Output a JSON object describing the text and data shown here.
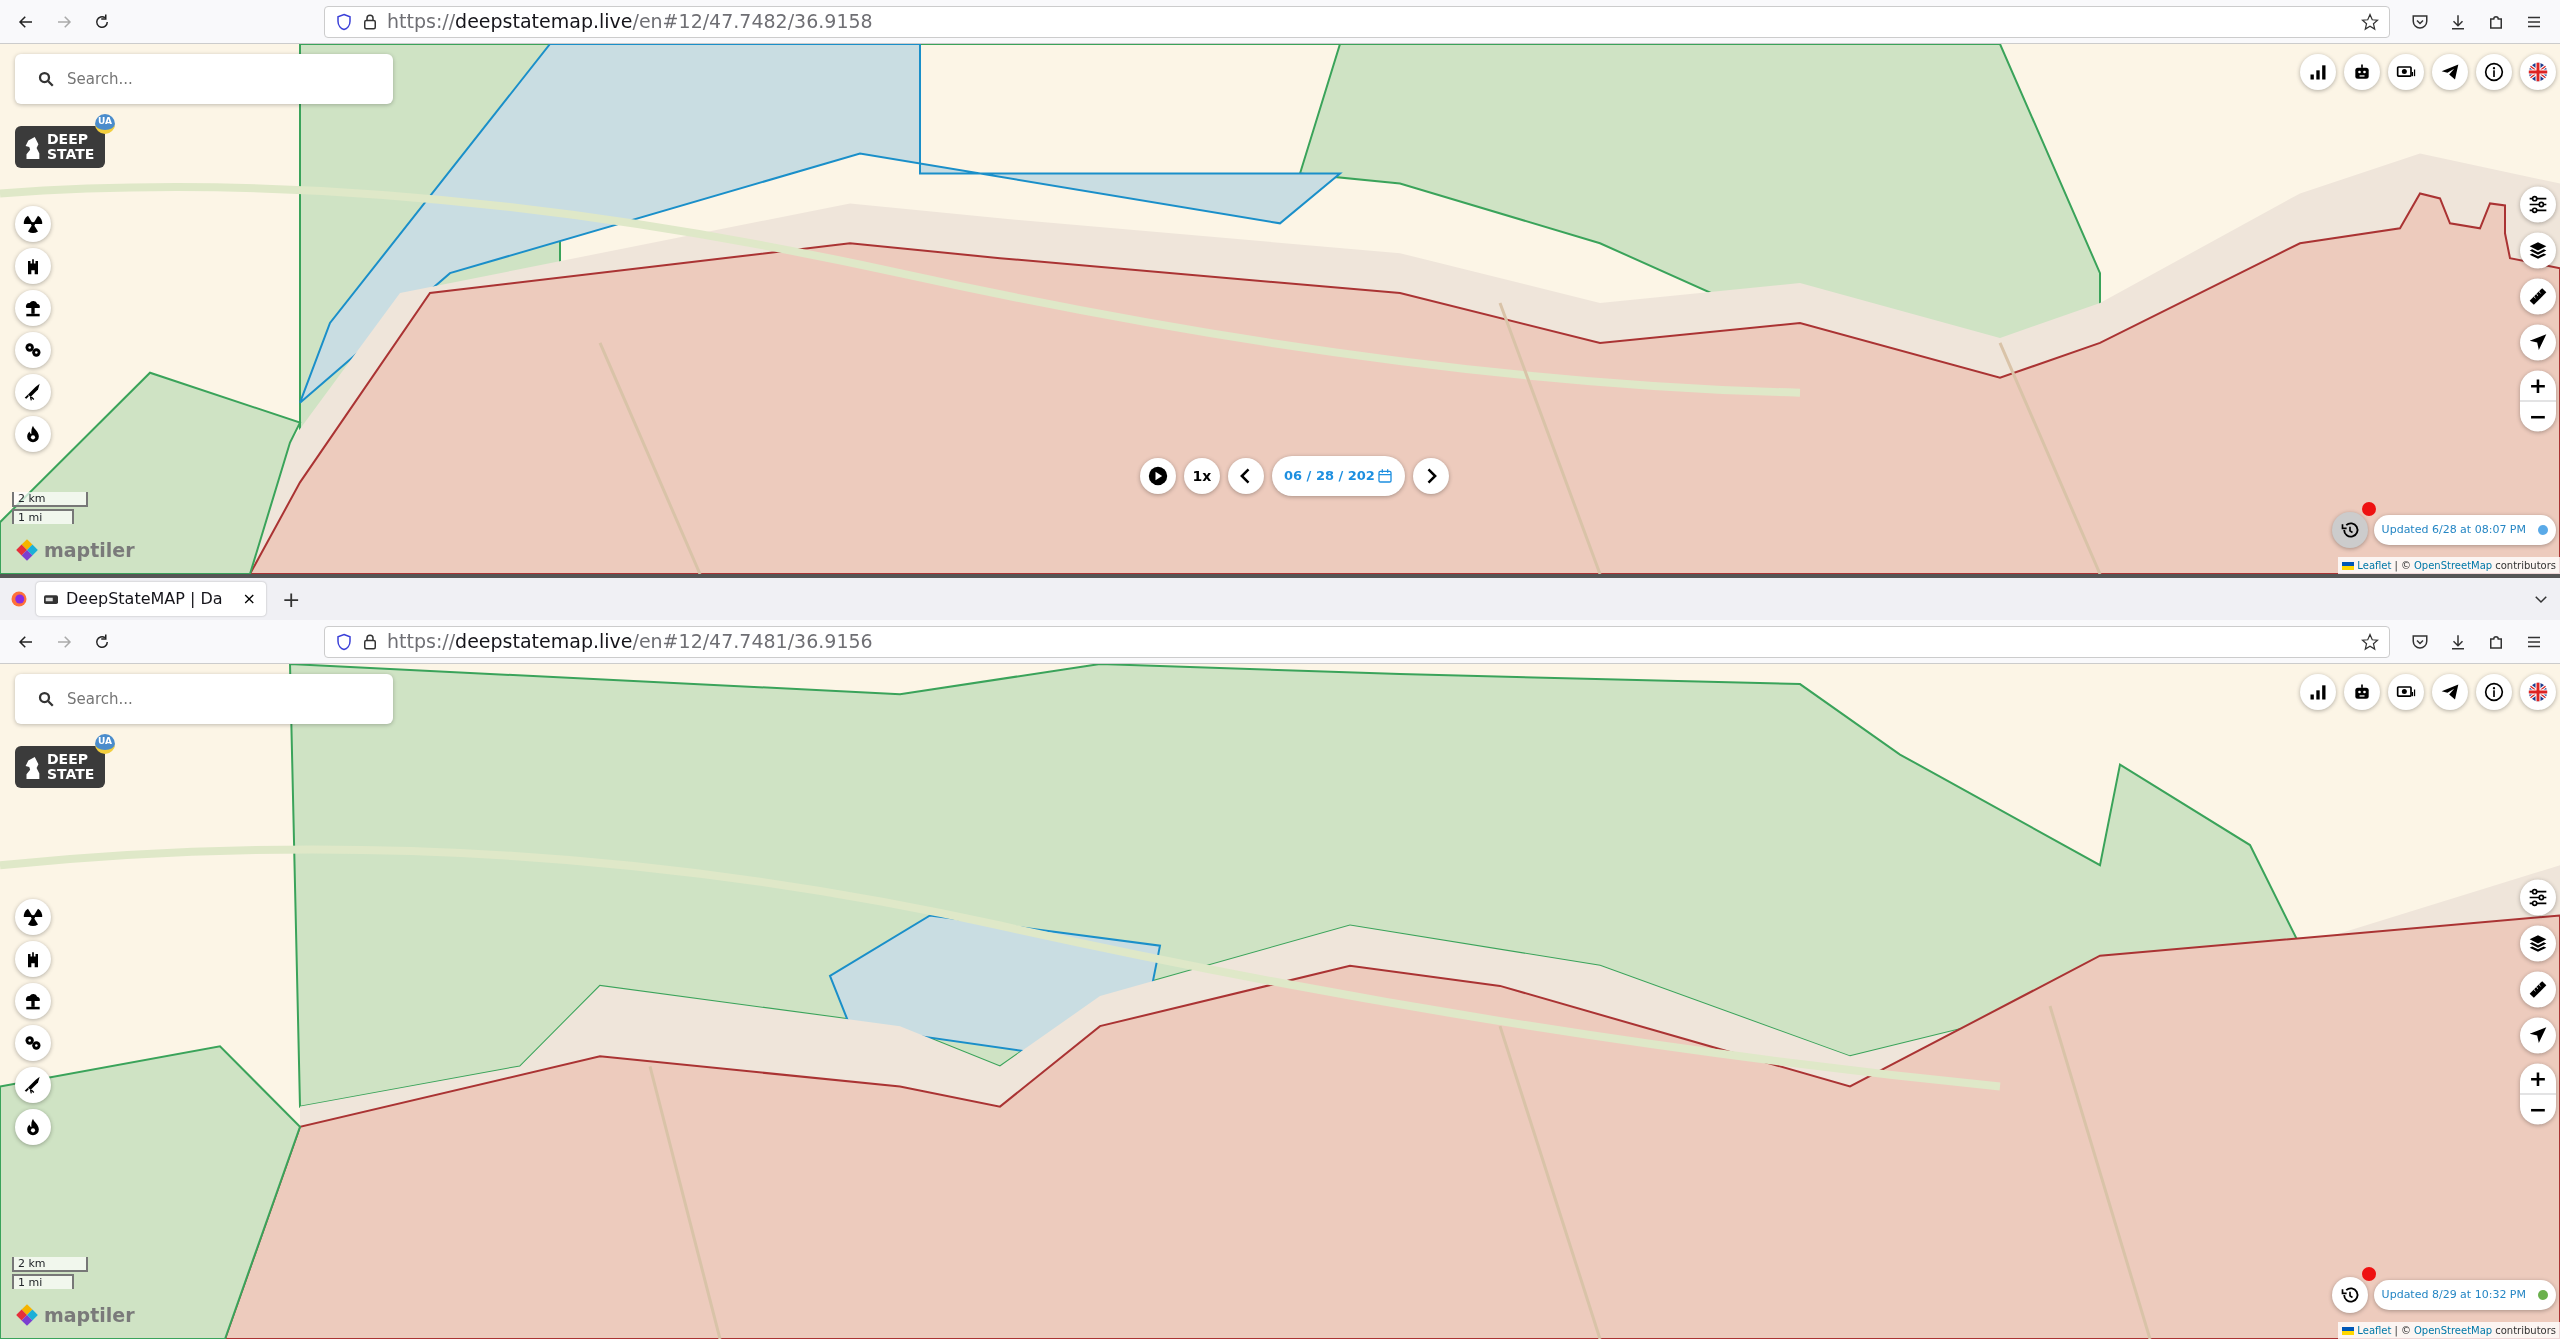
{
  "windows": [
    {
      "url": {
        "scheme": "https://",
        "host": "deepstatemap.live",
        "path": "/en#12/47.7482/36.9158"
      },
      "nav": [
        {
          "kind": "back",
          "disabled": false
        },
        {
          "kind": "forward",
          "disabled": true
        },
        {
          "kind": "reload",
          "disabled": false
        }
      ],
      "map": {
        "kind": "picture",
        "search": {
          "placeholder": "Search..."
        },
        "logo": {
          "line1": "DEEP",
          "line2": "STATE",
          "badge": "UA"
        },
        "layer_buttons": [
          {
            "kind": "radiation"
          },
          {
            "kind": "tower"
          },
          {
            "kind": "explosion"
          },
          {
            "kind": "gears"
          },
          {
            "kind": "rocket"
          },
          {
            "kind": "fire"
          }
        ],
        "scale": {
          "metric": "2 km",
          "imperial": "1 mi"
        },
        "maptiler": "maptiler",
        "timeline": {
          "speed": "1x",
          "date": "06 / 28 / 202"
        },
        "top_buttons": [
          {
            "kind": "stats"
          },
          {
            "kind": "robot"
          },
          {
            "kind": "donate"
          },
          {
            "kind": "telegram"
          },
          {
            "kind": "info"
          },
          {
            "kind": "flag"
          }
        ],
        "tool_buttons": [
          {
            "kind": "filters"
          },
          {
            "kind": "layers"
          },
          {
            "kind": "ruler"
          },
          {
            "kind": "locate"
          }
        ],
        "zoom": {
          "in": "+",
          "out": "−"
        },
        "updated": {
          "text": "Updated 6/28 at 08:07 PM",
          "color": "#5aaae8"
        },
        "attribution": {
          "link1": "Leaflet",
          "separator": "| ©",
          "link2": "OpenStreetMap",
          "suffix": "contributors"
        }
      }
    },
    {
      "tabs": [
        {
          "title": "DeepStateMAP | Da",
          "selected": true,
          "close": "×"
        }
      ],
      "new_tab": "+",
      "url": {
        "scheme": "https://",
        "host": "deepstatemap.live",
        "path": "/en#12/47.7481/36.9156"
      },
      "nav": [
        {
          "kind": "back",
          "disabled": false
        },
        {
          "kind": "forward",
          "disabled": true
        },
        {
          "kind": "reload",
          "disabled": false
        }
      ],
      "map": {
        "kind": "picture",
        "search": {
          "placeholder": "Search..."
        },
        "logo": {
          "line1": "DEEP",
          "line2": "STATE",
          "badge": "UA"
        },
        "layer_buttons": [
          {
            "kind": "radiation"
          },
          {
            "kind": "tower"
          },
          {
            "kind": "explosion"
          },
          {
            "kind": "gears"
          },
          {
            "kind": "rocket"
          },
          {
            "kind": "fire"
          }
        ],
        "scale": {
          "metric": "2 km",
          "imperial": "1 mi"
        },
        "maptiler": "maptiler",
        "top_buttons": [
          {
            "kind": "stats"
          },
          {
            "kind": "robot"
          },
          {
            "kind": "donate"
          },
          {
            "kind": "telegram"
          },
          {
            "kind": "info"
          },
          {
            "kind": "flag"
          }
        ],
        "tool_buttons": [
          {
            "kind": "filters"
          },
          {
            "kind": "layers"
          },
          {
            "kind": "ruler"
          },
          {
            "kind": "locate"
          }
        ],
        "zoom": {
          "in": "+",
          "out": "−"
        },
        "updated": {
          "text": "Updated 8/29 at 10:32 PM",
          "color": "#6ab04c"
        },
        "attribution": {
          "link1": "Leaflet",
          "separator": "| ©",
          "link2": "OpenStreetMap",
          "suffix": "contributors"
        }
      }
    }
  ]
}
